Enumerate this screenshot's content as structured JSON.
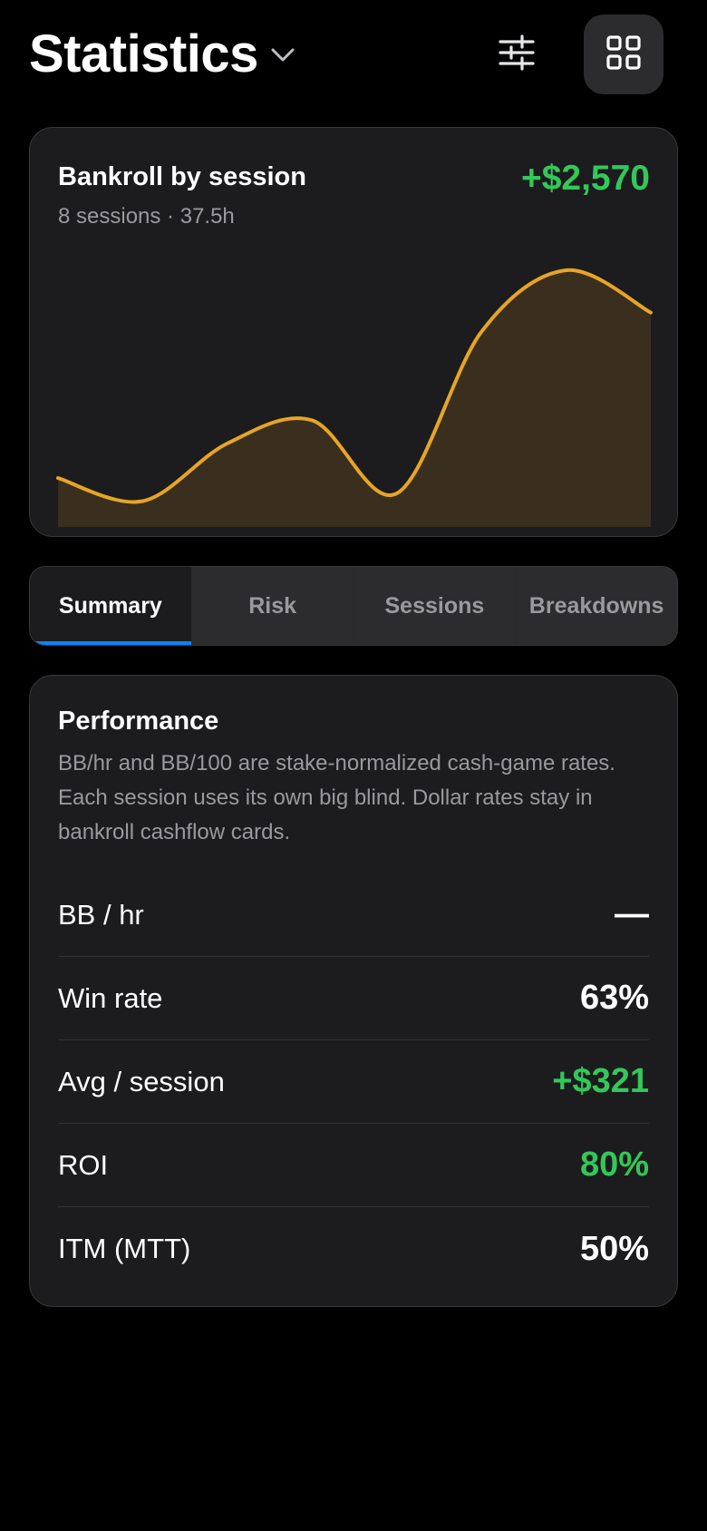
{
  "header": {
    "title": "Statistics"
  },
  "chart_card": {
    "title": "Bankroll by session",
    "subtitle": "8 sessions · 37.5h",
    "total": "+$2,570"
  },
  "chart_data": {
    "type": "area",
    "title": "Bankroll by session",
    "x": [
      1,
      2,
      3,
      4,
      5,
      6,
      7,
      8
    ],
    "series": [
      {
        "values": [
          0,
          -60,
          90,
          150,
          -40,
          380,
          540,
          430
        ]
      }
    ],
    "ylim": [
      -80,
      580
    ],
    "grid": false,
    "legend": "none"
  },
  "tabs": [
    {
      "label": "Summary",
      "active": true
    },
    {
      "label": "Risk",
      "active": false
    },
    {
      "label": "Sessions",
      "active": false
    },
    {
      "label": "Breakdowns",
      "active": false
    }
  ],
  "performance": {
    "title": "Performance",
    "description": "BB/hr and BB/100 are stake-normalized cash-game rates. Each session uses its own big blind. Dollar rates stay in bankroll cashflow cards.",
    "metrics": [
      {
        "label": "BB / hr",
        "value": "—",
        "tone": "neutral"
      },
      {
        "label": "Win rate",
        "value": "63%",
        "tone": "neutral"
      },
      {
        "label": "Avg / session",
        "value": "+$321",
        "tone": "pos"
      },
      {
        "label": "ROI",
        "value": "80%",
        "tone": "pos"
      },
      {
        "label": "ITM (MTT)",
        "value": "50%",
        "tone": "neutral"
      }
    ]
  },
  "colors": {
    "positive": "#34c759",
    "accent_line": "#e6a526",
    "tab_indicator": "#0a84ff"
  },
  "icons": {
    "title_dropdown": "chevron-down-icon",
    "filter": "sliders-icon",
    "layout": "grid-icon"
  }
}
